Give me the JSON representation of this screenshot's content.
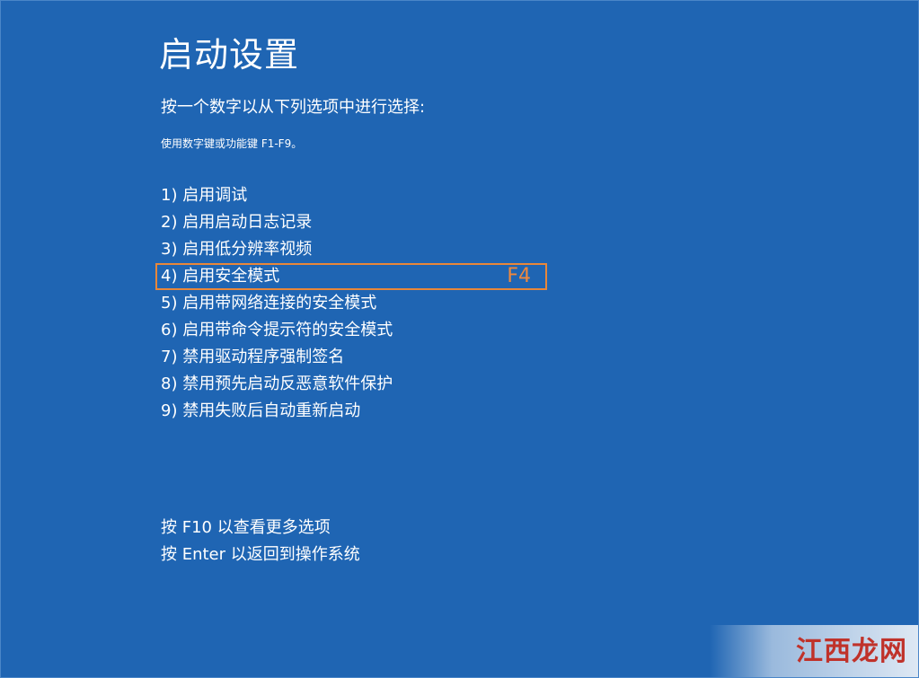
{
  "screen": {
    "title": "启动设置",
    "instruction": "按一个数字以从下列选项中进行选择:",
    "hint": "使用数字键或功能键 F1-F9。",
    "options": [
      {
        "label": "1) 启用调试"
      },
      {
        "label": "2) 启用启动日志记录"
      },
      {
        "label": "3) 启用低分辨率视频"
      },
      {
        "label": "4) 启用安全模式",
        "annotation": "F4"
      },
      {
        "label": "5) 启用带网络连接的安全模式"
      },
      {
        "label": "6) 启用带命令提示符的安全模式"
      },
      {
        "label": "7) 禁用驱动程序强制签名"
      },
      {
        "label": "8) 禁用预先启动反恶意软件保护"
      },
      {
        "label": "9) 禁用失败后自动重新启动"
      }
    ],
    "footer": {
      "more_options": "按 F10 以查看更多选项",
      "return": "按 Enter 以返回到操作系统"
    }
  },
  "watermark": {
    "text": "江西龙网"
  },
  "colors": {
    "background": "#1f65b3",
    "text": "#ffffff",
    "highlight_border": "#e8873a",
    "annotation": "#f0883c",
    "watermark": "#c0322a"
  }
}
